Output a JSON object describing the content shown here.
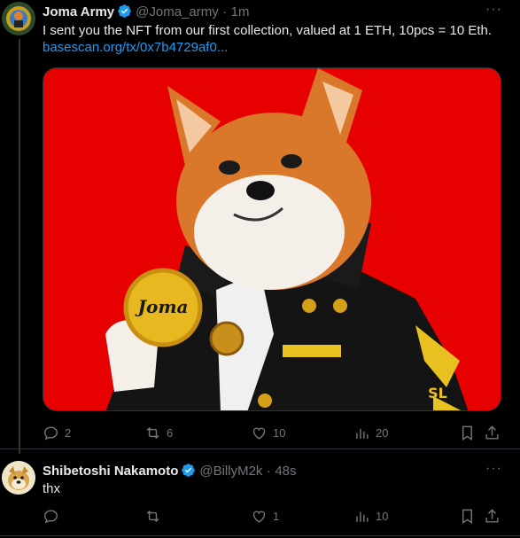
{
  "tweet": {
    "author_name": "Joma Army",
    "handle": "@Joma_army",
    "separator": "·",
    "time": "1m",
    "text": "I sent you the NFT from our first collection, valued at 1 ETH, 10pcs = 10 Eth.",
    "link": "basescan.org/tx/0x7b4729af0...",
    "more_icon": "more-dots-icon",
    "media": {
      "description_icon": "shiba-dog-image",
      "coin_text": "Joma",
      "badge_text": "SL",
      "background_color": "#e60000"
    },
    "actions": {
      "replies": "2",
      "reposts": "6",
      "likes": "10",
      "views": "20"
    }
  },
  "reply": {
    "author_name": "Shibetoshi Nakamoto",
    "handle": "@BillyM2k",
    "separator": "·",
    "time": "48s",
    "text": "thx",
    "actions": {
      "replies": "",
      "reposts": "",
      "likes": "1",
      "views": "10"
    }
  },
  "colors": {
    "accent": "#1d9bf0",
    "muted": "#71767b",
    "background": "#000000"
  }
}
